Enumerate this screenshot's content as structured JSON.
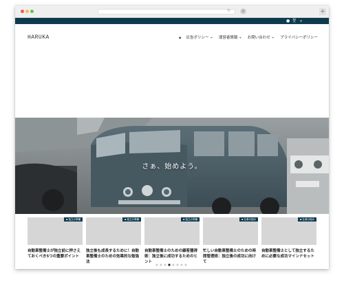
{
  "header": {
    "logo": "HARUKA"
  },
  "nav": {
    "items": [
      {
        "label": "広告ポリシー"
      },
      {
        "label": "運営者情報"
      },
      {
        "label": "お問い合わせ"
      },
      {
        "label": "プライバシーポリシー"
      }
    ]
  },
  "hero": {
    "text": "さぁ、始めよう。"
  },
  "cards": [
    {
      "badge": "独立の準備",
      "title": "自動車整備士が独立前に押さえておくべき5つの重要ポイント"
    },
    {
      "badge": "独立の準備",
      "title": "独立後も成長するために！自動車整備士のための効果的な勉強法"
    },
    {
      "badge": "独立の準備",
      "title": "自動車整備士のための顧客獲得術：独立後に成功するためのヒント"
    },
    {
      "badge": "仕事の悩み",
      "title": "忙しい自動車整備士のための時間管理術：独立後の成功に向けて"
    },
    {
      "badge": "仕事の悩み",
      "title": "自動車整備士として独立するために必要な成功マインドセット"
    }
  ],
  "colors": {
    "accent": "#0e3a4f"
  }
}
